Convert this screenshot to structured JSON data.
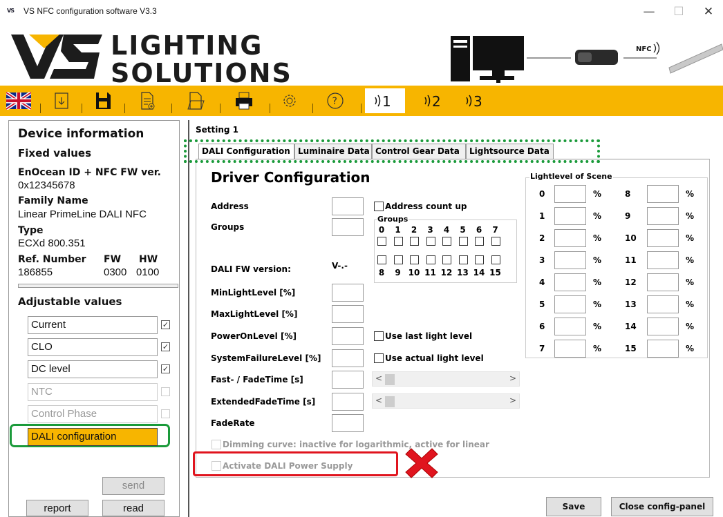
{
  "window": {
    "icon_text": "VS",
    "title": "VS NFC configuration software V3.3",
    "minimize": "—",
    "maximize": "☐",
    "close": "✕"
  },
  "logo": {
    "line1": "LIGHTING",
    "line2": "SOLUTIONS",
    "nfc_label": "NFC"
  },
  "toolbar": {
    "items": [
      "flag-uk-icon",
      "import-icon",
      "save-icon",
      "new-document-icon",
      "open-document-icon",
      "print-icon",
      "settings-icon",
      "help-icon",
      "nfc-slot-1-icon",
      "nfc-slot-2-icon",
      "nfc-slot-3-icon"
    ],
    "accent": "#f7b500"
  },
  "left": {
    "device_information": "Device information",
    "fixed_values": "Fixed values",
    "enocean_label": "EnOcean ID + NFC FW ver.",
    "enocean_value": "0x12345678",
    "family_label": "Family Name",
    "family_value": "Linear PrimeLine DALI NFC",
    "type_label": "Type",
    "type_value": "ECXd 800.351",
    "ref_label": "Ref. Number",
    "fw_label": "FW",
    "hw_label": "HW",
    "ref_value": "186855",
    "fw_value": "0300",
    "hw_value": "0100",
    "adjustable_values": "Adjustable values",
    "adjustable": [
      {
        "label": "Current",
        "checked": true,
        "enabled": true
      },
      {
        "label": "CLO",
        "checked": true,
        "enabled": true
      },
      {
        "label": "DC level",
        "checked": true,
        "enabled": true
      },
      {
        "label": "NTC",
        "checked": false,
        "enabled": false
      },
      {
        "label": "Control Phase",
        "checked": false,
        "enabled": false
      }
    ],
    "selected_item": "DALI configuration",
    "send": "send",
    "report": "report",
    "read": "read",
    "highlight_color": "#f7b500"
  },
  "main": {
    "setting": "Setting 1",
    "tabs": [
      "DALI Configuration",
      "Luminaire Data",
      "Control Gear Data",
      "Lightsource Data"
    ],
    "heading": "Driver Configuration",
    "address": "Address",
    "address_count_up": "Address count up",
    "groups": "Groups",
    "groups_box": "Groups",
    "groups_top": [
      "0",
      "1",
      "2",
      "3",
      "4",
      "5",
      "6",
      "7"
    ],
    "groups_bottom": [
      "8",
      "9",
      "10",
      "11",
      "12",
      "13",
      "14",
      "15"
    ],
    "dali_fw_version": "DALI FW version:",
    "dali_fw_value": "V-.-",
    "min_light": "MinLightLevel [%]",
    "max_light": "MaxLightLevel [%]",
    "power_on": "PowerOnLevel [%]",
    "use_last": "Use last light level",
    "system_failure": "SystemFailureLevel [%]",
    "use_actual": "Use actual light level",
    "fade_time": "Fast- / FadeTime [s]",
    "extended_fade": "ExtendedFadeTime  [s]",
    "fade_rate": "FadeRate",
    "dimming_curve": "Dimming curve: inactive for logarithmic, active for linear",
    "dali_power": "Activate DALI Power Supply",
    "scene_title": "Lightlevel of Scene",
    "scenes_left": [
      "0",
      "1",
      "2",
      "3",
      "4",
      "5",
      "6",
      "7"
    ],
    "scenes_right": [
      "8",
      "9",
      "10",
      "11",
      "12",
      "13",
      "14",
      "15"
    ],
    "pct": "%",
    "save": "Save",
    "close_panel": "Close config-panel"
  },
  "annotations": {
    "tab_highlight_color": "#1a9a3a",
    "left_highlight_color": "#1a9a3a",
    "power_highlight_color": "#e0141e",
    "cross_color": "#e0141e"
  }
}
